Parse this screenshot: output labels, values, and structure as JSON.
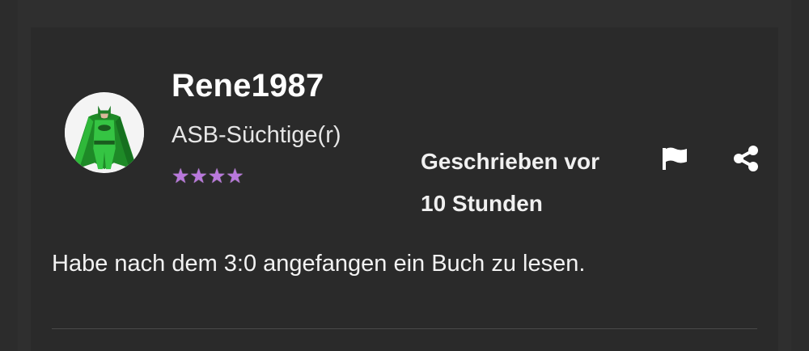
{
  "post": {
    "username": "Rene1987",
    "rank": "ASB-Süchtige(r)",
    "stars": [
      "★",
      "★",
      "★",
      "★"
    ],
    "time_line1": "Geschrieben vor",
    "time_line2": "10 Stunden",
    "body": "Habe nach dem 3:0 angefangen ein Buch zu lesen."
  },
  "icons": {
    "flag": "flag-icon",
    "share": "share-icon",
    "avatar": "batman-avatar"
  },
  "colors": {
    "background": "#2c2c2c",
    "card": "#2a2a2a",
    "text": "#ffffff",
    "stars": "#b978dc",
    "avatar_figure": "#2fae3a"
  }
}
